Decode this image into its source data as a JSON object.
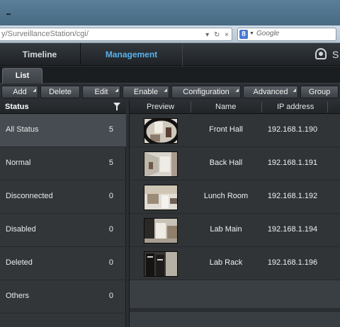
{
  "browser": {
    "url": "y/SurveillanceStation/cgi/",
    "search_placeholder": "Google",
    "search_engine_badge": "8"
  },
  "header": {
    "tabs": [
      {
        "label": "Timeline",
        "active": false
      },
      {
        "label": "Management",
        "active": true
      }
    ],
    "user_initial": "S"
  },
  "subtabs": [
    {
      "label": "List",
      "active": true
    }
  ],
  "toolbar": {
    "buttons": [
      {
        "label": "Add",
        "has_menu": true
      },
      {
        "label": "Delete",
        "has_menu": false
      },
      {
        "label": "Edit",
        "has_menu": true
      },
      {
        "label": "Enable",
        "has_menu": true
      },
      {
        "label": "Configuration",
        "has_menu": true
      },
      {
        "label": "Advanced",
        "has_menu": true
      },
      {
        "label": "Group",
        "has_menu": false
      }
    ]
  },
  "status_panel": {
    "title": "Status",
    "filter_icon": "filter-icon",
    "items": [
      {
        "label": "All Status",
        "count": "5",
        "selected": true
      },
      {
        "label": "Normal",
        "count": "5",
        "selected": false
      },
      {
        "label": "Disconnected",
        "count": "0",
        "selected": false
      },
      {
        "label": "Disabled",
        "count": "0",
        "selected": false
      },
      {
        "label": "Deleted",
        "count": "0",
        "selected": false
      },
      {
        "label": "Others",
        "count": "0",
        "selected": false
      }
    ]
  },
  "camera_table": {
    "columns": [
      "Preview",
      "Name",
      "IP address"
    ],
    "rows": [
      {
        "name": "Front Hall",
        "ip": "192.168.1.190"
      },
      {
        "name": "Back Hall",
        "ip": "192.168.1.191"
      },
      {
        "name": "Lunch Room",
        "ip": "192.168.1.192"
      },
      {
        "name": "Lab Main",
        "ip": "192.168.1.194"
      },
      {
        "name": "Lab Rack",
        "ip": "192.168.1.196"
      }
    ]
  },
  "colors": {
    "active_tab": "#58b2ef",
    "selected_row": "#464c51"
  }
}
